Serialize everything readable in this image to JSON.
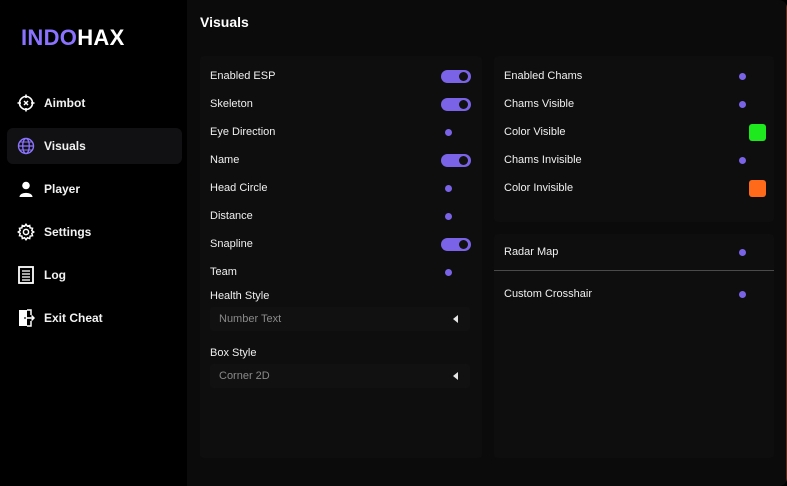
{
  "app": {
    "logo_accent": "INDO",
    "logo_rest": "HAX",
    "accent_color": "#8b73ff"
  },
  "sidebar": {
    "items": [
      {
        "label": "Aimbot",
        "icon": "crosshair-icon",
        "active": false
      },
      {
        "label": "Visuals",
        "icon": "globe-icon",
        "active": true
      },
      {
        "label": "Player",
        "icon": "user-icon",
        "active": false
      },
      {
        "label": "Settings",
        "icon": "gear-icon",
        "active": false
      },
      {
        "label": "Log",
        "icon": "document-icon",
        "active": false
      },
      {
        "label": "Exit Cheat",
        "icon": "exit-door-icon",
        "active": false
      }
    ]
  },
  "main": {
    "title": "Visuals",
    "esp": {
      "rows": [
        {
          "label": "Enabled ESP",
          "control": "toggle",
          "on": true
        },
        {
          "label": "Skeleton",
          "control": "toggle",
          "on": true
        },
        {
          "label": "Eye Direction",
          "control": "dot",
          "on": false
        },
        {
          "label": "Name",
          "control": "toggle",
          "on": true
        },
        {
          "label": "Head Circle",
          "control": "dot",
          "on": false
        },
        {
          "label": "Distance",
          "control": "dot",
          "on": false
        },
        {
          "label": "Snapline",
          "control": "toggle",
          "on": true
        },
        {
          "label": "Team",
          "control": "dot",
          "on": false
        }
      ],
      "health_style": {
        "label": "Health Style",
        "value": "Number Text"
      },
      "box_style": {
        "label": "Box Style",
        "value": "Corner 2D"
      }
    },
    "chams": {
      "rows": [
        {
          "label": "Enabled Chams",
          "control": "dot"
        },
        {
          "label": "Chams Visible",
          "control": "dot"
        },
        {
          "label": "Color Visible",
          "control": "swatch",
          "color": "#1ee81e"
        },
        {
          "label": "Chams Invisible",
          "control": "dot"
        },
        {
          "label": "Color Invisible",
          "control": "swatch",
          "color": "#ff6a1a"
        }
      ]
    },
    "misc": {
      "radar_map": "Radar Map",
      "custom_crosshair": "Custom Crosshair"
    }
  }
}
